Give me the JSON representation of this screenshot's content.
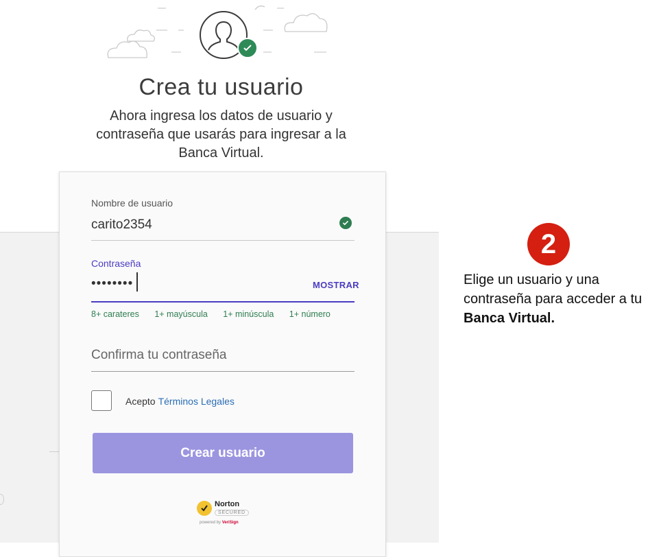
{
  "header": {
    "title": "Crea tu usuario",
    "subtitle": "Ahora ingresa los datos de usuario y contraseña que usarás para ingresar a la Banca Virtual."
  },
  "form": {
    "username": {
      "label": "Nombre de usuario",
      "value": "carito2354",
      "valid": true
    },
    "password": {
      "label": "Contraseña",
      "value": "••••••••",
      "show_label": "MOSTRAR"
    },
    "requirements": [
      "8+ carateres",
      "1+ mayúscula",
      "1+ minúscula",
      "1+ número"
    ],
    "confirm": {
      "placeholder": "Confirma tu contraseña"
    },
    "terms": {
      "prefix": "Acepto",
      "link": "Términos Legales",
      "checked": false
    },
    "submit_label": "Crear usuario"
  },
  "seal": {
    "name": "Norton",
    "secured": "SECURED",
    "powered_prefix": "powered by",
    "powered_brand": "VeriSign"
  },
  "annotation": {
    "step": "2",
    "text_plain": "Elige un usuario y una contraseña para acceder a tu",
    "text_bold": "Banca Virtual."
  },
  "colors": {
    "accent": "#4b3cc2",
    "button": "#9b95e0",
    "success": "#2e7d50",
    "badge": "#d41f11",
    "link": "#2a6db5"
  }
}
